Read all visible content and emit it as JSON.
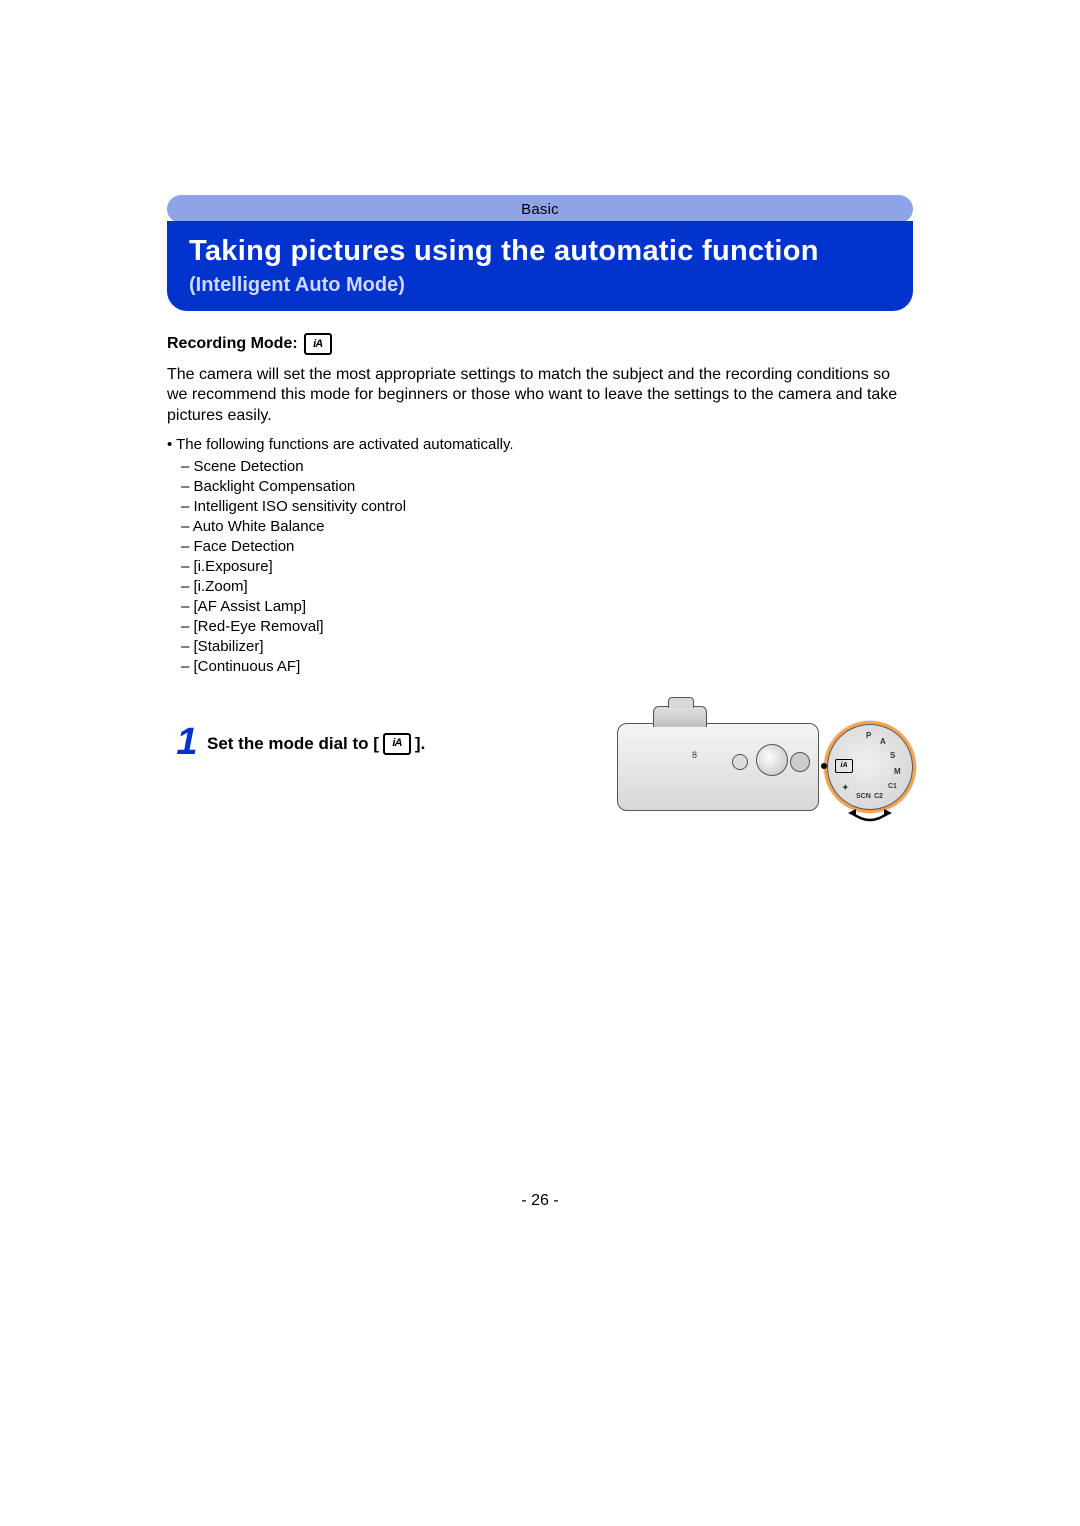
{
  "chapter": "Basic",
  "title": "Taking pictures using the automatic function",
  "subtitle": "(Intelligent Auto Mode)",
  "recording_mode_label": "Recording Mode:",
  "ia_icon_glyph": "iA",
  "intro_paragraph": "The camera will set the most appropriate settings to match the subject and the recording conditions so we recommend this mode for beginners or those who want to leave the settings to the camera and take pictures easily.",
  "auto_functions_intro": "• The following functions are activated automatically.",
  "auto_functions": [
    "Scene Detection",
    "Backlight Compensation",
    "Intelligent ISO sensitivity control",
    "Auto White Balance",
    "Face Detection",
    "[i.Exposure]",
    "[i.Zoom]",
    "[AF Assist Lamp]",
    "[Red-Eye Removal]",
    "[Stabilizer]",
    "[Continuous AF]"
  ],
  "step": {
    "number": "1",
    "text_before": "Set the mode dial to [",
    "text_after": "]."
  },
  "camera_body_label": "8",
  "dial_positions": {
    "P": "P",
    "A": "A",
    "S": "S",
    "M": "M",
    "C1": "C1",
    "C2": "C2",
    "SCN": "SCN",
    "creative": "✦"
  },
  "page_number": "- 26 -"
}
